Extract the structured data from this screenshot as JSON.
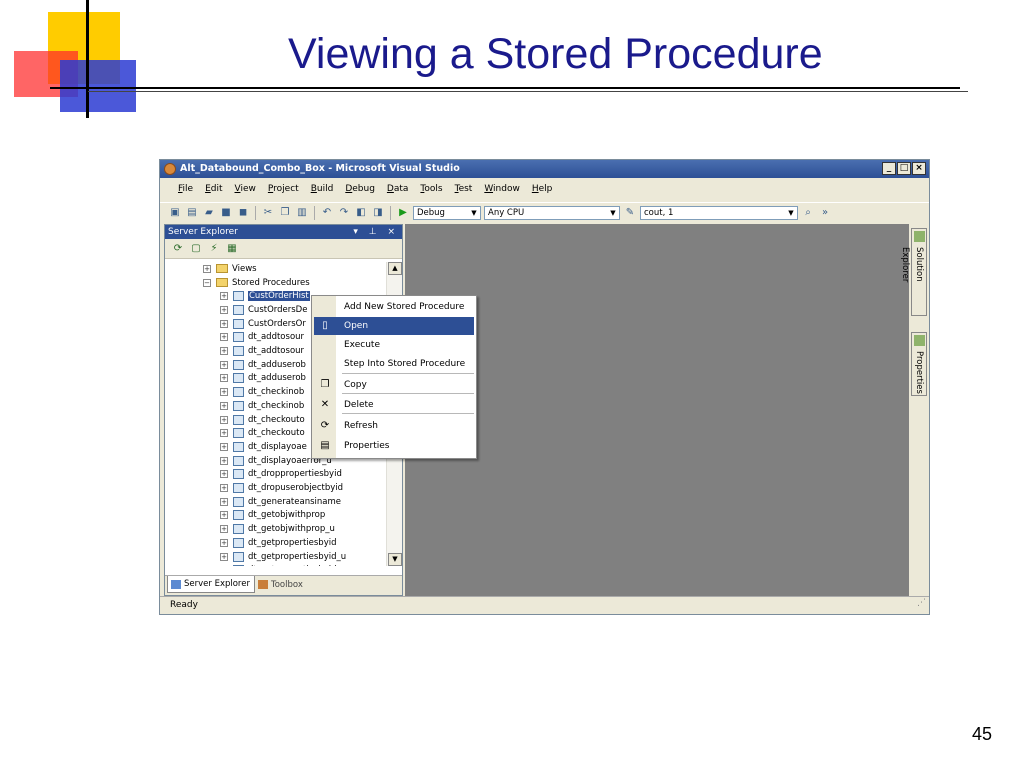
{
  "slide": {
    "title": "Viewing a Stored Procedure",
    "page_number": "45"
  },
  "window": {
    "title": "Alt_Databound_Combo_Box - Microsoft Visual Studio",
    "buttons": [
      "_",
      "□",
      "×"
    ]
  },
  "menubar": {
    "items": [
      "File",
      "Edit",
      "View",
      "Project",
      "Build",
      "Debug",
      "Data",
      "Tools",
      "Test",
      "Window",
      "Help"
    ]
  },
  "toolbar": {
    "config_combo": "Debug",
    "platform_combo": "Any CPU",
    "find_combo": "cout, 1"
  },
  "server_explorer": {
    "title": "Server Explorer",
    "header_controls": "▾ ⊥ ×",
    "tree": [
      {
        "label": "Views",
        "kind": "folder",
        "expander": "+"
      },
      {
        "label": "Stored Procedures",
        "kind": "folder",
        "expander": "−"
      },
      {
        "label": "CustOrderHist",
        "kind": "sp",
        "expander": "+",
        "selected": true
      },
      {
        "label": "CustOrdersDe",
        "kind": "sp",
        "expander": "+"
      },
      {
        "label": "CustOrdersOr",
        "kind": "sp",
        "expander": "+"
      },
      {
        "label": "dt_addtosour",
        "kind": "sp",
        "expander": "+"
      },
      {
        "label": "dt_addtosour",
        "kind": "sp",
        "expander": "+"
      },
      {
        "label": "dt_adduserob",
        "kind": "sp",
        "expander": "+"
      },
      {
        "label": "dt_adduserob",
        "kind": "sp",
        "expander": "+"
      },
      {
        "label": "dt_checkinob",
        "kind": "sp",
        "expander": "+"
      },
      {
        "label": "dt_checkinob",
        "kind": "sp",
        "expander": "+"
      },
      {
        "label": "dt_checkouto",
        "kind": "sp",
        "expander": "+"
      },
      {
        "label": "dt_checkouto",
        "kind": "sp",
        "expander": "+"
      },
      {
        "label": "dt_displayoae",
        "kind": "sp",
        "expander": "+"
      },
      {
        "label": "dt_displayoaerror_u",
        "kind": "sp",
        "expander": "+"
      },
      {
        "label": "dt_droppropertiesbyid",
        "kind": "sp",
        "expander": "+"
      },
      {
        "label": "dt_dropuserobjectbyid",
        "kind": "sp",
        "expander": "+"
      },
      {
        "label": "dt_generateansiname",
        "kind": "sp",
        "expander": "+"
      },
      {
        "label": "dt_getobjwithprop",
        "kind": "sp",
        "expander": "+"
      },
      {
        "label": "dt_getobjwithprop_u",
        "kind": "sp",
        "expander": "+"
      },
      {
        "label": "dt_getpropertiesbyid",
        "kind": "sp",
        "expander": "+"
      },
      {
        "label": "dt_getpropertiesbyid_u",
        "kind": "sp",
        "expander": "+"
      },
      {
        "label": "dt_getpropertiesbyid_vcs",
        "kind": "sp",
        "expander": "+"
      }
    ],
    "tabs": [
      "Server Explorer",
      "Toolbox"
    ]
  },
  "context_menu": {
    "items": [
      {
        "label": "Add New Stored Procedure",
        "icon": ""
      },
      {
        "label": "Open",
        "icon": "document-icon"
      },
      {
        "label": "Execute",
        "icon": ""
      },
      {
        "label": "Step Into Stored Procedure",
        "icon": ""
      },
      {
        "label": "Copy",
        "icon": "copy-icon"
      },
      {
        "label": "Delete",
        "icon": "delete-icon"
      },
      {
        "label": "Refresh",
        "icon": "refresh-icon"
      },
      {
        "label": "Properties",
        "icon": "properties-icon"
      }
    ]
  },
  "side_tabs": [
    "Solution Explorer",
    "Properties"
  ],
  "statusbar": {
    "text": "Ready"
  }
}
